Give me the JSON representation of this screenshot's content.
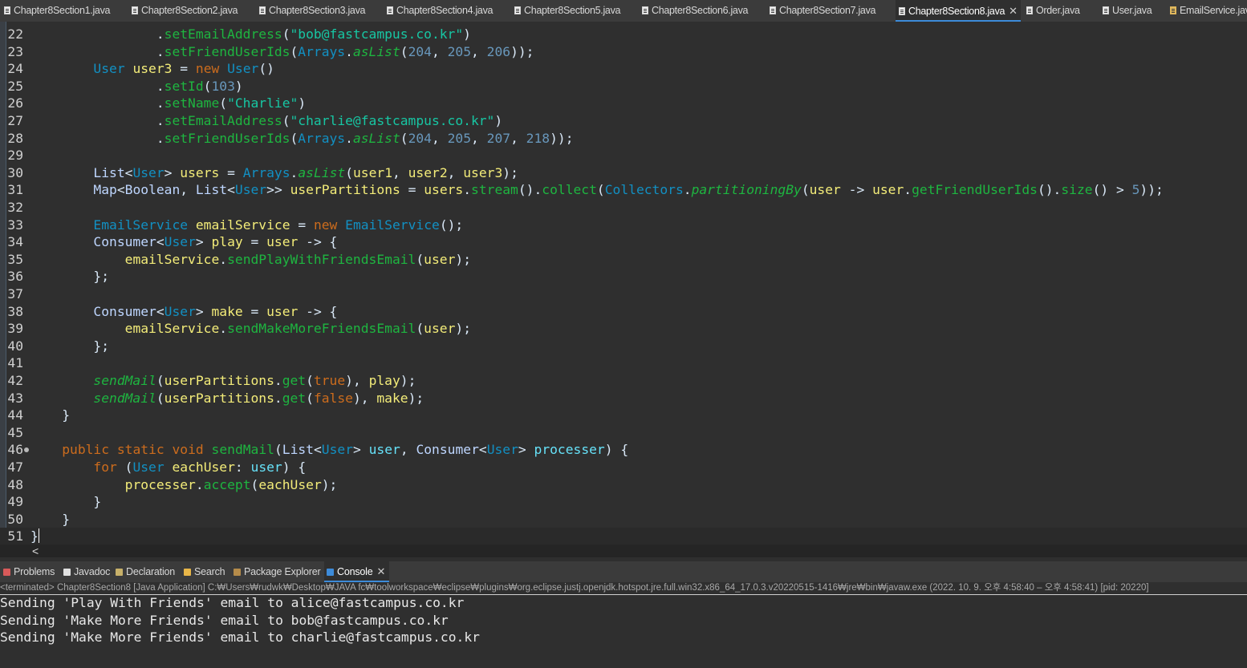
{
  "editor_tabs": [
    {
      "label": "Chapter8Section1.java",
      "active": false
    },
    {
      "label": "Chapter8Section2.java",
      "active": false
    },
    {
      "label": "Chapter8Section3.java",
      "active": false
    },
    {
      "label": "Chapter8Section4.java",
      "active": false
    },
    {
      "label": "Chapter8Section5.java",
      "active": false
    },
    {
      "label": "Chapter8Section6.java",
      "active": false
    },
    {
      "label": "Chapter8Section7.java",
      "active": false
    },
    {
      "label": "Chapter8Section8.java",
      "active": true,
      "close": "✕"
    },
    {
      "label": "Order.java",
      "active": false
    },
    {
      "label": "User.java",
      "active": false
    },
    {
      "label": "EmailService.java",
      "active": false
    }
  ],
  "code_lines": [
    {
      "num": "22",
      "text": "                .setEmailAddress(\"bob@fastcampus.co.kr\")"
    },
    {
      "num": "23",
      "text": "                .setFriendUserIds(Arrays.asList(204, 205, 206));"
    },
    {
      "num": "24",
      "text": "        User user3 = new User()"
    },
    {
      "num": "25",
      "text": "                .setId(103)"
    },
    {
      "num": "26",
      "text": "                .setName(\"Charlie\")"
    },
    {
      "num": "27",
      "text": "                .setEmailAddress(\"charlie@fastcampus.co.kr\")"
    },
    {
      "num": "28",
      "text": "                .setFriendUserIds(Arrays.asList(204, 205, 207, 218));"
    },
    {
      "num": "29",
      "text": ""
    },
    {
      "num": "30",
      "text": "        List<User> users = Arrays.asList(user1, user2, user3);"
    },
    {
      "num": "31",
      "text": "        Map<Boolean, List<User>> userPartitions = users.stream().collect(Collectors.partitioningBy(user -> user.getFriendUserIds().size() > 5));"
    },
    {
      "num": "32",
      "text": ""
    },
    {
      "num": "33",
      "text": "        EmailService emailService = new EmailService();"
    },
    {
      "num": "34",
      "text": "        Consumer<User> play = user -> {"
    },
    {
      "num": "35",
      "text": "            emailService.sendPlayWithFriendsEmail(user);"
    },
    {
      "num": "36",
      "text": "        };"
    },
    {
      "num": "37",
      "text": ""
    },
    {
      "num": "38",
      "text": "        Consumer<User> make = user -> {"
    },
    {
      "num": "39",
      "text": "            emailService.sendMakeMoreFriendsEmail(user);"
    },
    {
      "num": "40",
      "text": "        };"
    },
    {
      "num": "41",
      "text": ""
    },
    {
      "num": "42",
      "text": "        sendMail(userPartitions.get(true), play);"
    },
    {
      "num": "43",
      "text": "        sendMail(userPartitions.get(false), make);"
    },
    {
      "num": "44",
      "text": "    }"
    },
    {
      "num": "45",
      "text": ""
    },
    {
      "num": "46",
      "text": "    public static void sendMail(List<User> user, Consumer<User> processer) {"
    },
    {
      "num": "47",
      "text": "        for (User eachUser: user) {"
    },
    {
      "num": "48",
      "text": "            processer.accept(eachUser);"
    },
    {
      "num": "49",
      "text": "        }"
    },
    {
      "num": "50",
      "text": "    }"
    },
    {
      "num": "51",
      "text": "}"
    }
  ],
  "scroll_left_glyph": "<",
  "view_tabs": [
    {
      "label": "Problems",
      "active": false,
      "icon": "problems-icon",
      "color": "#d85a5a"
    },
    {
      "label": "Javadoc",
      "active": false,
      "icon": "javadoc-icon",
      "color": "#e0e0e0"
    },
    {
      "label": "Declaration",
      "active": false,
      "icon": "declaration-icon",
      "color": "#c8b16a"
    },
    {
      "label": "Search",
      "active": false,
      "icon": "search-icon",
      "color": "#e8b648"
    },
    {
      "label": "Package Explorer",
      "active": false,
      "icon": "package-explorer-icon",
      "color": "#b58b4a"
    },
    {
      "label": "Console",
      "active": true,
      "icon": "console-icon",
      "color": "#3d8bd9",
      "close": "✕"
    }
  ],
  "console": {
    "header": "<terminated> Chapter8Section8 [Java Application] C:₩Users₩rudwk₩Desktop₩JAVA fc₩toolworkspace₩eclipse₩plugins₩org.eclipse.justj.openjdk.hotspot.jre.full.win32.x86_64_17.0.3.v20220515-1416₩jre₩bin₩javaw.exe  (2022. 10. 9. 오후 4:58:40 – 오후 4:58:41) [pid: 20220]",
    "lines": [
      "Sending 'Play With Friends' email to alice@fastcampus.co.kr",
      "Sending 'Make More Friends' email to bob@fastcampus.co.kr",
      "Sending 'Make More Friends' email to charlie@fastcampus.co.kr"
    ]
  },
  "colors": {
    "background": "#2f2f2f",
    "keyword": "#cc6c1d",
    "method": "#1eb540",
    "type": "#1290c3",
    "string": "#17c6a3",
    "number": "#6897bb",
    "active_tab_accent": "#3d8bd9"
  }
}
